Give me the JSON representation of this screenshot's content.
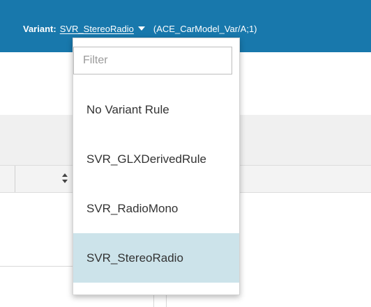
{
  "header": {
    "variant_label": "Variant:",
    "variant_value": "SVR_StereoRadio",
    "variant_info": "(ACE_CarModel_Var/A;1)"
  },
  "dropdown": {
    "filter_placeholder": "Filter",
    "filter_value": "",
    "items": [
      {
        "label": "No Variant Rule",
        "selected": false
      },
      {
        "label": "SVR_GLXDerivedRule",
        "selected": false
      },
      {
        "label": "SVR_RadioMono",
        "selected": false
      },
      {
        "label": "SVR_StereoRadio",
        "selected": true
      }
    ]
  },
  "colors": {
    "header_bg": "#1878ac",
    "selected_bg": "#cce3ea"
  },
  "icons": {
    "caret": "caret-down-icon",
    "sort": "sort-icon"
  }
}
